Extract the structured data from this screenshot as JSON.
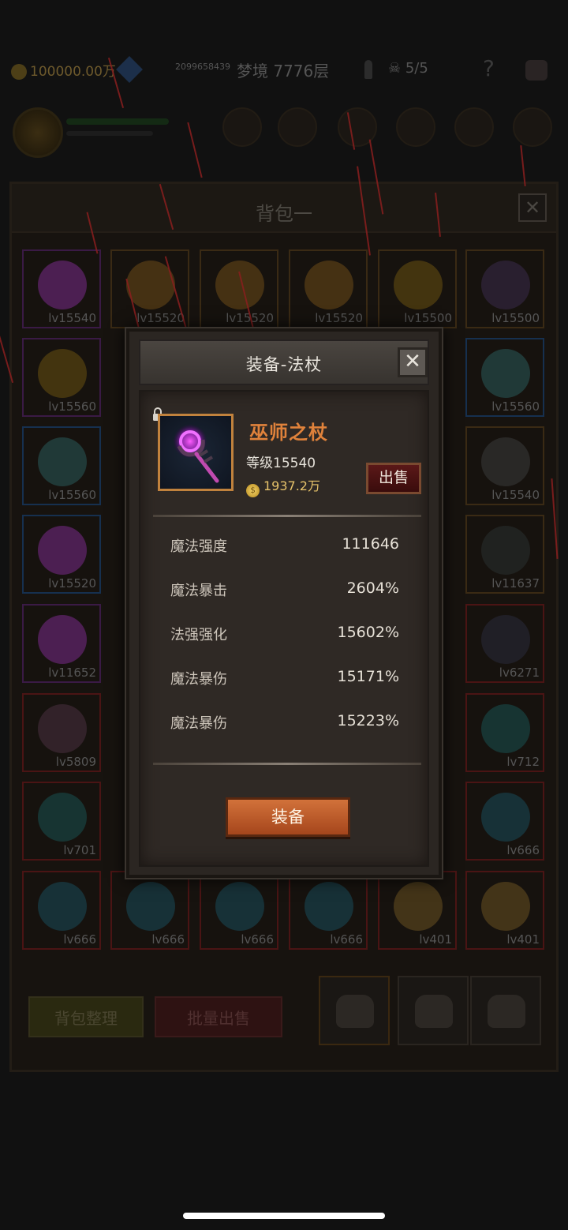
{
  "status_bar": {
    "gold": "100000.00万",
    "id_text": "2099658439",
    "floor": "梦境 7776层",
    "skull_count": "5/5",
    "help": "?"
  },
  "bag": {
    "title": "背包一",
    "close": "✕",
    "slots": [
      {
        "lv": "lv15540",
        "color": "purple",
        "art": "#7a2a8a"
      },
      {
        "lv": "lv15520",
        "color": "",
        "art": "#6e4a18"
      },
      {
        "lv": "lv15520",
        "color": "",
        "art": "#6e4a18"
      },
      {
        "lv": "lv15520",
        "color": "",
        "art": "#6e4a18"
      },
      {
        "lv": "lv15500",
        "color": "",
        "art": "#6a5010"
      },
      {
        "lv": "lv15500",
        "color": "",
        "art": "#3a2a4a"
      },
      {
        "lv": "lv15560",
        "color": "purple",
        "art": "#6a5010"
      },
      {
        "lv": "lv15560",
        "color": "blue",
        "art": "#2a5a5a"
      },
      {
        "lv": "lv15560",
        "color": "blue",
        "art": "#2a5a5a"
      },
      {
        "lv": "lv15540",
        "color": "",
        "art": "#3a3a3a"
      },
      {
        "lv": "lv15520",
        "color": "blue",
        "art": "#7a2a8a"
      },
      {
        "lv": "lv11637",
        "color": "",
        "art": "#2a3030"
      },
      {
        "lv": "lv11652",
        "color": "purple",
        "art": "#7a2a8a"
      },
      {
        "lv": "lv6271",
        "color": "red",
        "art": "#2a2a3a"
      },
      {
        "lv": "lv5809",
        "color": "red",
        "art": "#4a3040"
      },
      {
        "lv": "lv712",
        "color": "red",
        "art": "#1a5050"
      },
      {
        "lv": "lv701",
        "color": "red",
        "art": "#1a5050"
      },
      {
        "lv": "lv666",
        "color": "red",
        "art": "#1a4a5a"
      },
      {
        "lv": "lv666",
        "color": "red",
        "art": "#1a4a5a"
      },
      {
        "lv": "lv666",
        "color": "red",
        "art": "#1a4a5a"
      },
      {
        "lv": "lv666",
        "color": "red",
        "art": "#1a4a5a"
      },
      {
        "lv": "lv666",
        "color": "red",
        "art": "#1a4a5a"
      },
      {
        "lv": "lv401",
        "color": "red",
        "art": "#6a5020"
      },
      {
        "lv": "lv401",
        "color": "red",
        "art": "#6a5020"
      }
    ],
    "tidy_button": "背包整理",
    "sell_all_button": "批量出售"
  },
  "dialog": {
    "title": "装备-法杖",
    "close": "✕",
    "item": {
      "name": "巫师之杖",
      "level": "等级15540",
      "price": "1937.2万",
      "coin_symbol": "$"
    },
    "sell_button": "出售",
    "stats": [
      {
        "name": "魔法强度",
        "value": "111646"
      },
      {
        "name": "魔法暴击",
        "value": "2604%"
      },
      {
        "name": "法强强化",
        "value": "15602%"
      },
      {
        "name": "魔法暴伤",
        "value": "15171%"
      },
      {
        "name": "魔法暴伤",
        "value": "15223%"
      }
    ],
    "equip_button": "装备"
  },
  "colors": {
    "accent_orange": "#e0823b",
    "frame_gold": "#c1823d",
    "sell_red": "#5a1818",
    "equip_orange": "#c5622e"
  }
}
